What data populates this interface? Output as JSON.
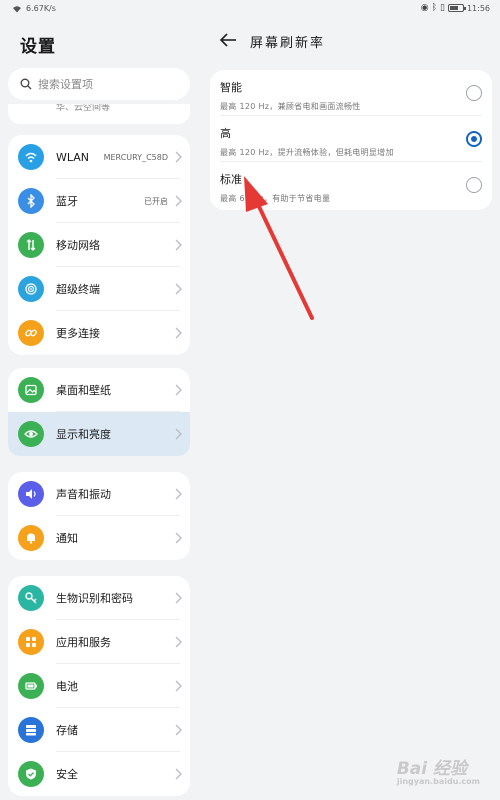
{
  "statusbar": {
    "speed": "6.67K/s",
    "time": "11:56"
  },
  "left": {
    "title": "设置",
    "search_placeholder": "搜索设置项",
    "partial_text": "华、云空间等",
    "groups": [
      [
        {
          "label": "WLAN",
          "value": "MERCURY_C58D",
          "icon": "wifi-icon",
          "color": "#29a0e6"
        },
        {
          "label": "蓝牙",
          "value": "已开启",
          "icon": "bluetooth-icon",
          "color": "#3a8ee6"
        },
        {
          "label": "移动网络",
          "value": "",
          "icon": "mobile-data-icon",
          "color": "#3cb054"
        },
        {
          "label": "超级终端",
          "value": "",
          "icon": "super-device-icon",
          "color": "#2ba3dc"
        },
        {
          "label": "更多连接",
          "value": "",
          "icon": "link-icon",
          "color": "#f5a11b"
        }
      ],
      [
        {
          "label": "桌面和壁纸",
          "value": "",
          "icon": "wallpaper-icon",
          "color": "#3cb054"
        },
        {
          "label": "显示和亮度",
          "value": "",
          "icon": "eye-icon",
          "color": "#3cb054"
        }
      ],
      [
        {
          "label": "声音和振动",
          "value": "",
          "icon": "sound-icon",
          "color": "#5b5ee8"
        },
        {
          "label": "通知",
          "value": "",
          "icon": "bell-icon",
          "color": "#f5a11b"
        }
      ],
      [
        {
          "label": "生物识别和密码",
          "value": "",
          "icon": "key-icon",
          "color": "#2bb5a3"
        },
        {
          "label": "应用和服务",
          "value": "",
          "icon": "apps-icon",
          "color": "#f5a11b"
        },
        {
          "label": "电池",
          "value": "",
          "icon": "battery-icon",
          "color": "#3cb054"
        },
        {
          "label": "存储",
          "value": "",
          "icon": "storage-icon",
          "color": "#2a73d8"
        },
        {
          "label": "安全",
          "value": "",
          "icon": "shield-icon",
          "color": "#3cb054"
        }
      ]
    ]
  },
  "right": {
    "title": "屏幕刷新率",
    "options": [
      {
        "title": "智能",
        "desc": "最高 120 Hz，兼顾省电和画面流畅性",
        "selected": false
      },
      {
        "title": "高",
        "desc": "最高 120 Hz，提升流畅体验，但耗电明显增加",
        "selected": true
      },
      {
        "title": "标准",
        "desc": "最高 60 Hz，有助于节省电量",
        "selected": false
      }
    ]
  },
  "colors": {
    "accent": "#1565c0",
    "arrow": "#e53935",
    "selected_bg": "#dce9f5"
  },
  "watermark": {
    "brand": "Bai 经验",
    "sub": "jingyan.baidu.com"
  }
}
